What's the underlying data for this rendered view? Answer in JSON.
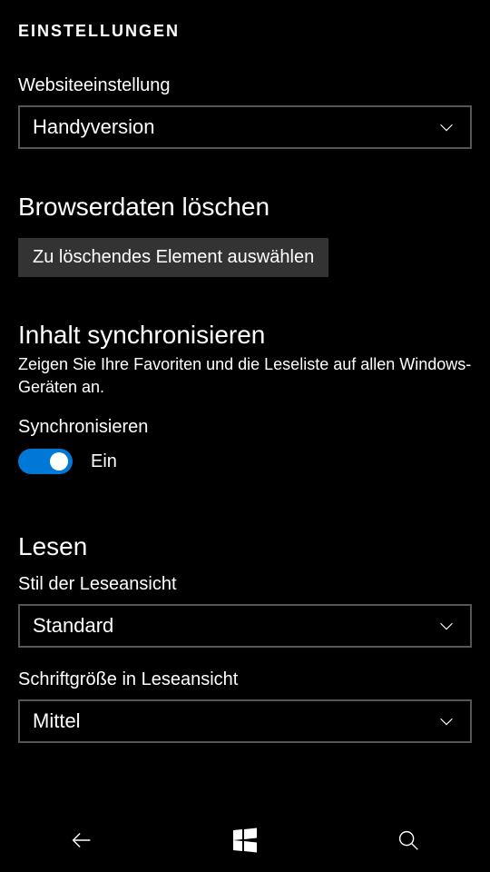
{
  "header": {
    "title": "EINSTELLUNGEN"
  },
  "website": {
    "label": "Websiteeinstellung",
    "value": "Handyversion"
  },
  "clearData": {
    "title": "Browserdaten löschen",
    "button": "Zu löschendes Element auswählen"
  },
  "sync": {
    "title": "Inhalt synchronisieren",
    "description": "Zeigen Sie Ihre Favoriten und die Leseliste auf allen Windows-Geräten an.",
    "toggleLabel": "Synchronisieren",
    "stateLabel": "Ein"
  },
  "reading": {
    "title": "Lesen",
    "styleLabel": "Stil der Leseansicht",
    "styleValue": "Standard",
    "fontLabel": "Schriftgröße in Leseansicht",
    "fontValue": "Mittel"
  }
}
